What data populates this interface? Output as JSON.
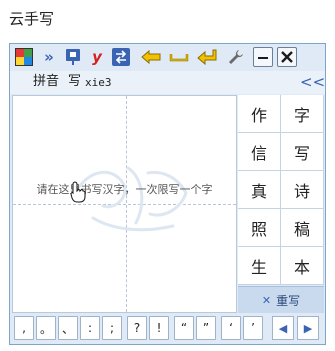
{
  "page": {
    "title": "云手写"
  },
  "toolbar": {
    "buttons": [
      "app-logo",
      "expand",
      "input-mode",
      "handwriting-y",
      "switch",
      "back",
      "space",
      "enter",
      "settings"
    ],
    "icons": {
      "expand": "»",
      "y": "y",
      "back_arrow": "⇦",
      "space": "⎵",
      "enter": "↵",
      "settings": "wrench",
      "minimize": "—",
      "close": "✕"
    }
  },
  "mode": {
    "pinyin_label": "拼音",
    "current_char": "写",
    "pinyin_value": "xie3",
    "collapse_icon": "<<"
  },
  "writing_area": {
    "hint": "请在这里书写汉字，一次限写一个字"
  },
  "candidates": [
    "作",
    "字",
    "信",
    "写",
    "真",
    "诗",
    "照",
    "稿",
    "生",
    "本"
  ],
  "rewrite": {
    "icon": "✕",
    "label": "重写"
  },
  "punctuation": [
    ",",
    "。",
    "、",
    ":",
    ";",
    "?",
    "!",
    "“",
    "”",
    "‘",
    "’"
  ],
  "nav": {
    "prev": "◀",
    "next": "▶"
  },
  "colors": {
    "accent_blue": "#3a64b3",
    "toolbar_yellow": "#f2c200",
    "toolbar_red": "#d32020",
    "window_bg": "#dfeaf6"
  }
}
